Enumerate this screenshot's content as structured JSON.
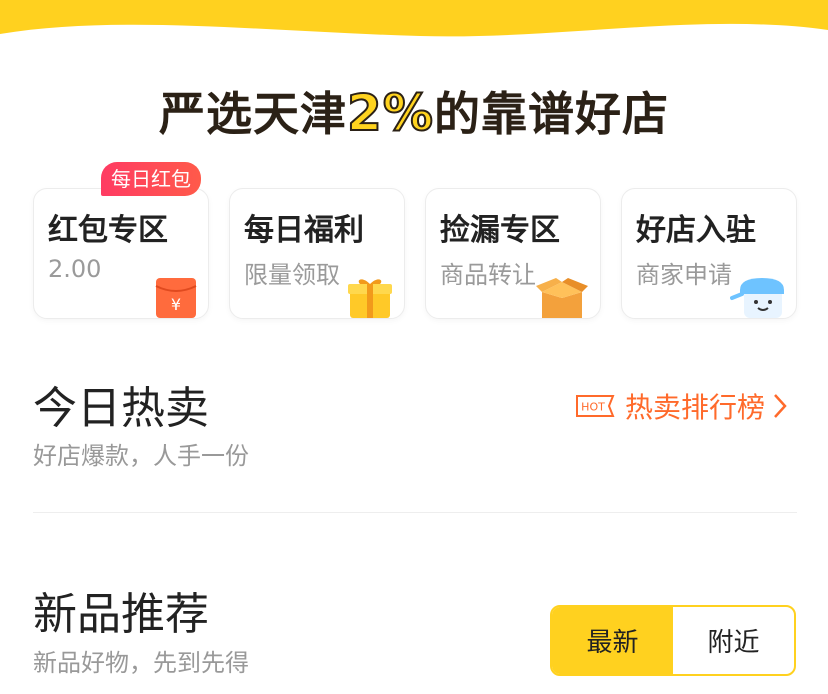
{
  "colors": {
    "brand_yellow": "#ffd11f",
    "badge_red": "#ff3b63",
    "hot_orange": "#ff6a2b"
  },
  "header": {
    "headline_prefix": "严选天津",
    "headline_highlight": "2%",
    "headline_suffix": "的靠谱好店"
  },
  "badge": {
    "label": "每日红包"
  },
  "cards": [
    {
      "title": "红包专区",
      "subtitle": "2.00",
      "icon": "red-envelope-icon"
    },
    {
      "title": "每日福利",
      "subtitle": "限量领取",
      "icon": "gift-box-icon"
    },
    {
      "title": "捡漏专区",
      "subtitle": "商品转让",
      "icon": "open-box-icon"
    },
    {
      "title": "好店入驻",
      "subtitle": "商家申请",
      "icon": "shop-mascot-icon"
    }
  ],
  "hot": {
    "title": "今日热卖",
    "subtitle": "好店爆款，人手一份",
    "rank_label": "热卖排行榜",
    "hot_tag": "HOT"
  },
  "new": {
    "title": "新品推荐",
    "subtitle": "新品好物，先到先得",
    "tabs": [
      {
        "label": "最新",
        "active": true
      },
      {
        "label": "附近",
        "active": false
      }
    ]
  }
}
